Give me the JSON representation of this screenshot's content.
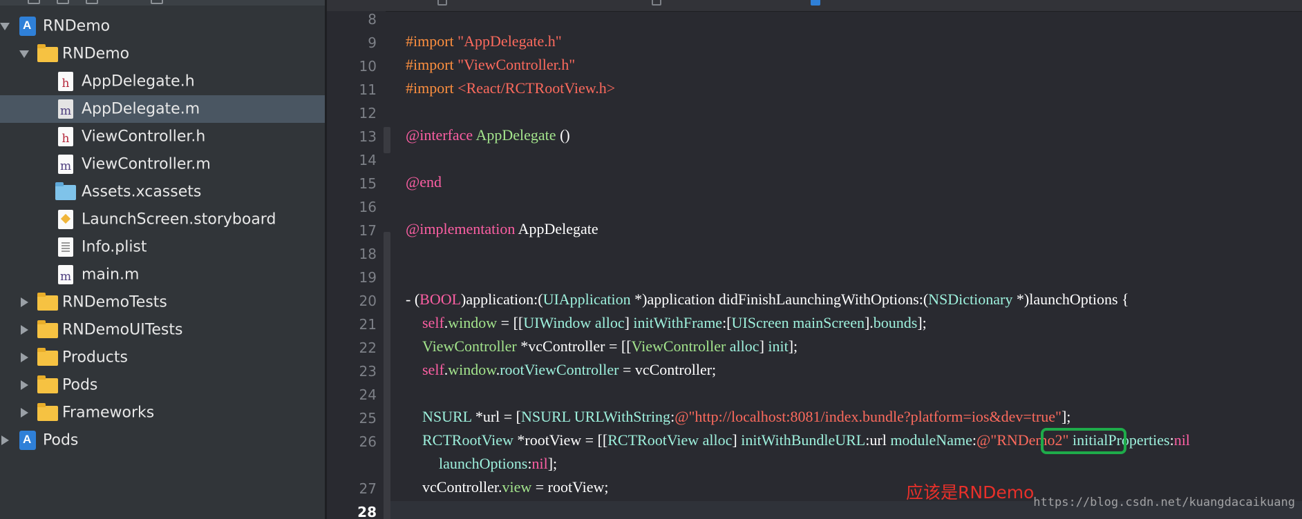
{
  "navigator": {
    "items": [
      {
        "label": "RNDemo",
        "icon": "project-icon",
        "disclosure": "open"
      },
      {
        "label": "RNDemo",
        "icon": "folder-icon",
        "disclosure": "open"
      },
      {
        "label": "AppDelegate.h",
        "icon": "header-file-icon",
        "glyph": "h"
      },
      {
        "label": "AppDelegate.m",
        "icon": "implementation-file-icon",
        "glyph": "m",
        "selected": true
      },
      {
        "label": "ViewController.h",
        "icon": "header-file-icon",
        "glyph": "h"
      },
      {
        "label": "ViewController.m",
        "icon": "implementation-file-icon",
        "glyph": "m"
      },
      {
        "label": "Assets.xcassets",
        "icon": "asset-catalog-icon"
      },
      {
        "label": "LaunchScreen.storyboard",
        "icon": "storyboard-file-icon"
      },
      {
        "label": "Info.plist",
        "icon": "plist-file-icon"
      },
      {
        "label": "main.m",
        "icon": "implementation-file-icon",
        "glyph": "m"
      },
      {
        "label": "RNDemoTests",
        "icon": "folder-icon",
        "disclosure": "closed"
      },
      {
        "label": "RNDemoUITests",
        "icon": "folder-icon",
        "disclosure": "closed"
      },
      {
        "label": "Products",
        "icon": "folder-icon",
        "disclosure": "closed"
      },
      {
        "label": "Pods",
        "icon": "folder-icon",
        "disclosure": "closed"
      },
      {
        "label": "Frameworks",
        "icon": "folder-icon",
        "disclosure": "closed"
      },
      {
        "label": "Pods",
        "icon": "project-icon",
        "disclosure": "closed"
      }
    ]
  },
  "editor": {
    "line_numbers": [
      "8",
      "9",
      "10",
      "11",
      "12",
      "13",
      "14",
      "15",
      "16",
      "17",
      "18",
      "19",
      "20",
      "21",
      "22",
      "23",
      "24",
      "25",
      "26",
      "",
      "27",
      "28"
    ],
    "current_line": "28",
    "code": {
      "l9_a": "#import ",
      "l9_b": "\"AppDelegate.h\"",
      "l10_a": "#import ",
      "l10_b": "\"ViewController.h\"",
      "l11_a": "#import ",
      "l11_b": "<React/RCTRootView.h>",
      "l13_a": "@interface",
      "l13_b": " AppDelegate",
      "l13_c": " ()",
      "l15_a": "@end",
      "l17_a": "@implementation",
      "l17_b": " AppDelegate",
      "l20_a": "- (",
      "l20_b": "BOOL",
      "l20_c": ")application:(",
      "l20_d": "UIApplication",
      "l20_e": " *)application didFinishLaunchingWithOptions:(",
      "l20_f": "NSDictionary",
      "l20_g": " *)launchOptions {",
      "l21_a": "self",
      "l21_b": ".",
      "l21_c": "window",
      "l21_d": " = [[",
      "l21_e": "UIWindow",
      "l21_f": " alloc",
      "l21_g": "] ",
      "l21_h": "initWithFrame",
      "l21_i": ":[",
      "l21_j": "UIScreen",
      "l21_k": " mainScreen",
      "l21_l": "].",
      "l21_m": "bounds",
      "l21_n": "];",
      "l22_a": "ViewController",
      "l22_b": " *vcController = [[",
      "l22_c": "ViewController",
      "l22_d": " alloc",
      "l22_e": "] ",
      "l22_f": "init",
      "l22_g": "];",
      "l23_a": "self",
      "l23_b": ".",
      "l23_c": "window",
      "l23_d": ".",
      "l23_e": "rootViewController",
      "l23_f": " = vcController;",
      "l25_a": "NSURL",
      "l25_b": " *url = [",
      "l25_c": "NSURL",
      "l25_d": " URLWithString",
      "l25_e": ":",
      "l25_f": "@\"http://localhost:8081/index.bundle?platform=ios&dev=true\"",
      "l25_g": "];",
      "l26_a": "RCTRootView",
      "l26_b": " *rootView = [[",
      "l26_c": "RCTRootView",
      "l26_d": " alloc",
      "l26_e": "] ",
      "l26_f": "initWithBundleURL",
      "l26_g": ":url ",
      "l26_h": "moduleName",
      "l26_i": ":",
      "l26_j": "@",
      "l26_k": "\"RNDemo2\"",
      "l26_l": " initialProperties",
      "l26_m": ":",
      "l26_n": "nil",
      "l26w_a": "launchOptions",
      "l26w_b": ":",
      "l26w_c": "nil",
      "l26w_d": "];",
      "l27_a": "vcController.",
      "l27_b": "view",
      "l27_c": " = rootView;"
    },
    "annotation": "应该是RNDemo",
    "watermark": "https://blog.csdn.net/kuangdacaikuang"
  },
  "colors": {
    "sidebar_bg": "#313539",
    "selection": "#4a5662",
    "editor_bg": "#292a30",
    "highlight_box": "#1eab4a",
    "annotation": "#e8302a"
  }
}
